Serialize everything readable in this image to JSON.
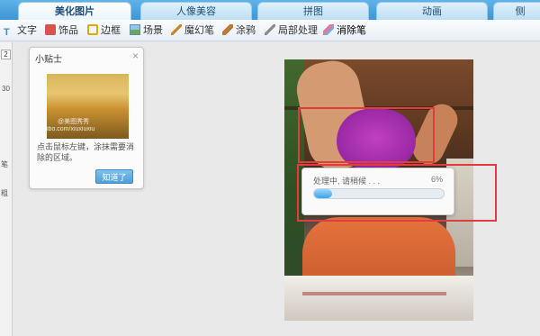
{
  "tabs": [
    {
      "label": "美化图片",
      "active": true
    },
    {
      "label": "人像美容",
      "active": false
    },
    {
      "label": "拼图",
      "active": false
    },
    {
      "label": "动画",
      "active": false
    },
    {
      "label": "侧",
      "active": false
    }
  ],
  "toolbar": {
    "items": [
      {
        "label": "文字",
        "icon": "text-icon"
      },
      {
        "label": "饰品",
        "icon": "gift-icon"
      },
      {
        "label": "边框",
        "icon": "frame-icon"
      },
      {
        "label": "场景",
        "icon": "scene-icon"
      },
      {
        "label": "魔幻笔",
        "icon": "magic-pen-icon"
      },
      {
        "label": "涂鸦",
        "icon": "doodle-brush-icon"
      },
      {
        "label": "局部处理",
        "icon": "local-process-icon"
      },
      {
        "label": "消除笔",
        "icon": "eraser-pen-icon",
        "active": true
      }
    ]
  },
  "left_strip": {
    "button": "2",
    "value": "30",
    "label1": "笔",
    "label2": "粗"
  },
  "tip_panel": {
    "title": "小贴士",
    "close": "×",
    "watermark": "@美图秀秀",
    "watermark2": "ibo.com/xiuxiuxiu",
    "text": "点击鼠标左键，涂抹需要消除的区域。",
    "button": "知道了"
  },
  "progress": {
    "text": "处理中, 请稍候 . . .",
    "percent_label": "6%",
    "percent": 6
  },
  "colors": {
    "accent": "#3d95d6",
    "selection": "#e23c3c",
    "progress_fill": "#3aa4ea"
  }
}
